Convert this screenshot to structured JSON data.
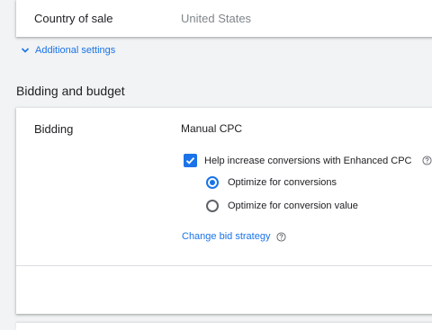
{
  "country_row": {
    "label": "Country of sale",
    "value": "United States"
  },
  "additional_settings": {
    "label": "Additional settings",
    "icon": "chevron-down-icon"
  },
  "section": {
    "title": "Bidding and budget"
  },
  "bidding": {
    "label": "Bidding",
    "value": "Manual CPC",
    "enhanced_cpc": {
      "label": "Help increase conversions with Enhanced CPC",
      "checked": true
    },
    "options": [
      {
        "label": "Optimize for conversions",
        "selected": true
      },
      {
        "label": "Optimize for conversion value",
        "selected": false
      }
    ],
    "change_link": "Change bid strategy"
  },
  "colors": {
    "accent": "#1a73e8",
    "text": "#202124",
    "muted": "#80868b",
    "background": "#f1f3f4"
  }
}
